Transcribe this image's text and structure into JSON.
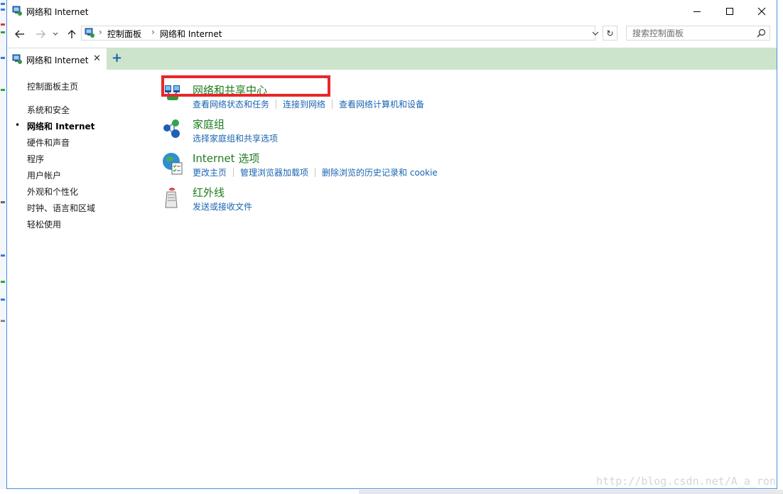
{
  "window": {
    "title": "网络和 Internet"
  },
  "address_bar": {
    "breadcrumbs": [
      "控制面板",
      "网络和 Internet"
    ],
    "search_placeholder": "搜索控制面板"
  },
  "tab": {
    "label": "网络和 Internet",
    "close_glyph": "✕",
    "new_tab_glyph": "+"
  },
  "sidebar": {
    "home": "控制面板主页",
    "items": [
      {
        "label": "系统和安全",
        "active": false
      },
      {
        "label": "网络和 Internet",
        "active": true
      },
      {
        "label": "硬件和声音",
        "active": false
      },
      {
        "label": "程序",
        "active": false
      },
      {
        "label": "用户帐户",
        "active": false
      },
      {
        "label": "外观和个性化",
        "active": false
      },
      {
        "label": "时钟、语言和区域",
        "active": false
      },
      {
        "label": "轻松使用",
        "active": false
      }
    ],
    "bullet": "•"
  },
  "sections": [
    {
      "title": "网络和共享中心",
      "icon": "network-sharing-center-icon",
      "links": [
        "查看网络状态和任务",
        "连接到网络",
        "查看网络计算机和设备"
      ],
      "highlighted": true
    },
    {
      "title": "家庭组",
      "icon": "homegroup-icon",
      "links": [
        "选择家庭组和共享选项"
      ]
    },
    {
      "title": "Internet 选项",
      "icon": "internet-options-icon",
      "links": [
        "更改主页",
        "管理浏览器加载项",
        "删除浏览的历史记录和 cookie"
      ]
    },
    {
      "title": "红外线",
      "icon": "infrared-icon",
      "links": [
        "发送或接收文件"
      ]
    }
  ],
  "watermark": "http://blog.csdn.net/A_a_ron",
  "colors": {
    "tab_bar": "#cce4cc",
    "section_title": "#1e7b1e",
    "link": "#1a64b0",
    "highlight_border": "#e8262b",
    "window_border": "#4a90d9"
  }
}
